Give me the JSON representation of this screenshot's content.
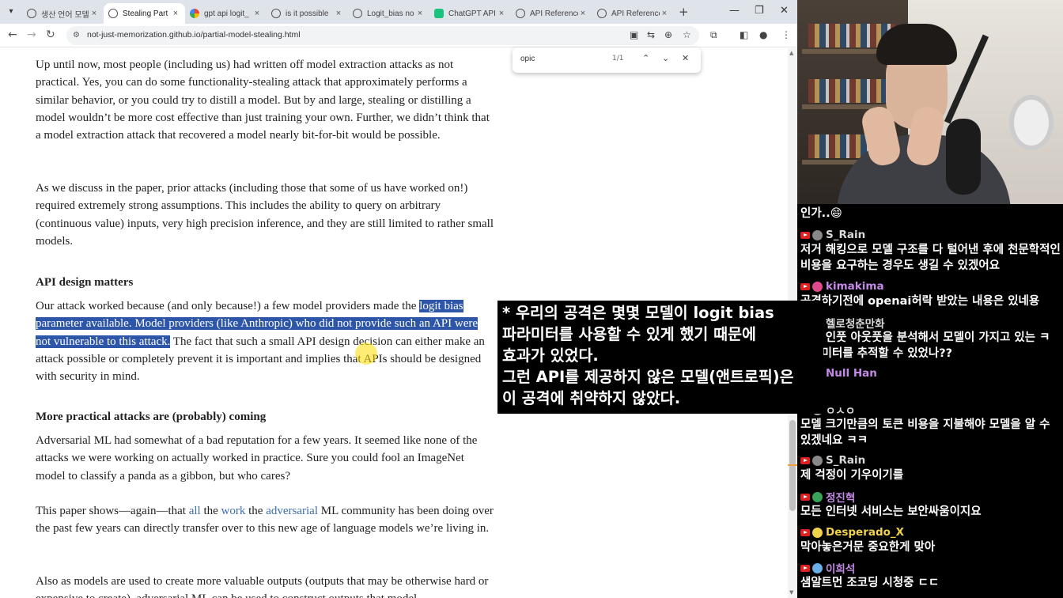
{
  "browser": {
    "tabs": [
      {
        "label": "생산 언어 모델",
        "icon": "globe-icon",
        "active": false
      },
      {
        "label": "Stealing Part",
        "icon": "globe-icon",
        "active": true
      },
      {
        "label": "gpt api logit_",
        "icon": "google-icon",
        "active": false
      },
      {
        "label": "is it possible",
        "icon": "openai-icon",
        "active": false
      },
      {
        "label": "Logit_bias no",
        "icon": "openai-icon",
        "active": false
      },
      {
        "label": "ChatGPT API",
        "icon": "v-icon",
        "active": false
      },
      {
        "label": "API Reference",
        "icon": "openai-icon",
        "active": false
      },
      {
        "label": "API Reference",
        "icon": "openai-icon",
        "active": false
      }
    ],
    "url": "not-just-memorization.github.io/partial-model-stealing.html",
    "find": {
      "query": "opic",
      "count": "1/1"
    }
  },
  "article": {
    "p1": "Up until now, most people (including us) had written off model extraction attacks as not practical. Yes, you can do some functionality-stealing attack that approximately performs a similar behavior, or you could try to distill a model. But by and large, stealing or distilling a model wouldn’t be more cost effective than just training your own. Further, we didn’t think that a model extraction attack that recovered a model nearly bit-for-bit would be possible.",
    "p2": "As we discuss in the paper, prior attacks (including those that some of us have worked on!) required extremely strong assumptions. This includes the ability to query on arbitrary (continuous value) inputs, very high precision inference, and they are still limited to rather small models.",
    "h_api": "API design matters",
    "p3_pre": "Our attack worked because (and only because!) a few model providers made the ",
    "p3_hl": "logit bias parameter available. Model providers (like Anthropic) who did not provide such an API were not vulnerable to this attack.",
    "p3_post": " The fact that such a small API design decision can either make an attack possible or completely prevent it is important and implies that APIs should be designed with security in mind.",
    "h_more": "More practical attacks are (probably) coming",
    "p4": "Adversarial ML had somewhat of a bad reputation for a few years. It seemed like none of the attacks we were working on actually worked in practice. Sure you could fool an ImageNet model to classify a panda as a gibbon, but who cares?",
    "p5_a": "This paper shows—again—that ",
    "p5_l1": "all",
    "p5_b": " the ",
    "p5_l2": "work",
    "p5_c": " the ",
    "p5_l3": "adversarial",
    "p5_d": " ML community has been doing over the past few years can directly transfer over to this new age of language models we’re living in.",
    "p6": "Also as models are used to create more valuable outputs (outputs that may be otherwise hard or expensive to create), adversarial ML can be used to construct outputs that model"
  },
  "subtitle": {
    "lines": [
      "* 우리의 공격은 몇몇 모델이 logit bias",
      "파라미터를 사용할 수 있게 했기 때문에",
      "효과가 있었다.",
      "그런 API를 제공하지 않은 모델(앤트로픽)은",
      "이 공격에 취약하지 않았다."
    ]
  },
  "chat": {
    "top_text": "인가..😄",
    "messages": [
      {
        "user": "S_Rain",
        "text": "저거 해킹으로 모델 구조를 다 털어낸 후에 천문학적인 비용을 요구하는 경우도 생길 수 있겠어요",
        "color": "#d9d9d9",
        "avatar": "#888888"
      },
      {
        "user": "kimakima",
        "text": "공격하기전에 openai허락 받았는 내용은 있네용",
        "color": "#c58ae8",
        "avatar": "#e04a8a"
      },
      {
        "user": "헬로청춘만화",
        "text": "번의 인풋 아웃풋을 분석해서 모델이 가지고 있는 ㅋ 파라미터를 추적할 수 있었나??",
        "color": "#d9d9d9",
        "avatar": "#5b7fd6"
      },
      {
        "user": "Null Han",
        "text": "듯",
        "color": "#c58ae8",
        "avatar": "#d05555"
      },
      {
        "user": "ㅇㅅㅇ",
        "text": "모델 크기만큼의 토큰 비용을 지불해야 모델을 알 수 있겠네요 ㅋㅋ",
        "color": "#d9d9d9",
        "avatar": "#aaaaaa"
      },
      {
        "user": "S_Rain",
        "text": "제 걱정이 기우이기를",
        "color": "#d9d9d9",
        "avatar": "#888888"
      },
      {
        "user": "정진혁",
        "text": "모든 인터넷 서비스는 보안싸움이지요",
        "color": "#c58ae8",
        "avatar": "#3aa35a"
      },
      {
        "user": "Desperado_X",
        "text": "막아놓은거문 중요한게 맞아",
        "color": "#f0d24a",
        "avatar": "#f0d24a"
      },
      {
        "user": "이희석",
        "text": "샘알트먼 조코딩 시청중 ㄷㄷ",
        "color": "#c58ae8",
        "avatar": "#6aaee8"
      }
    ]
  }
}
